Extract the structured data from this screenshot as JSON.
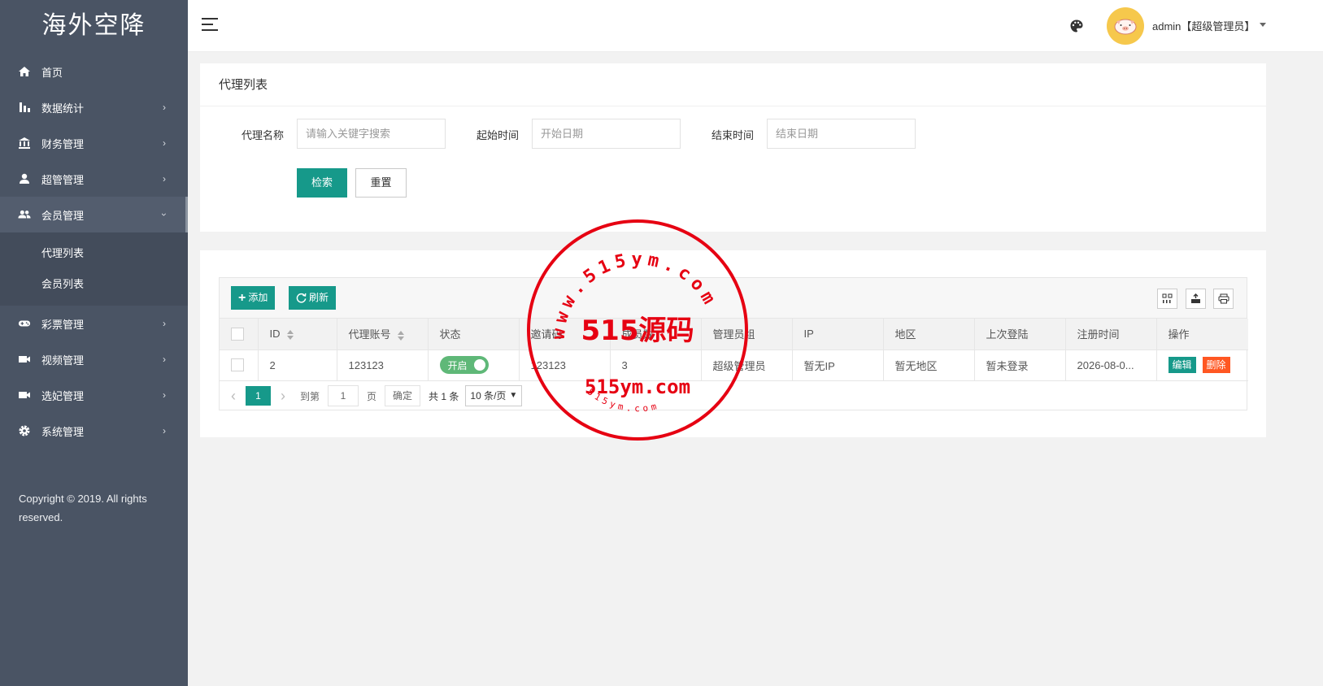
{
  "sidebar": {
    "logo": "海外空降",
    "items": [
      {
        "label": "首页",
        "icon": "home-icon",
        "arrow": ""
      },
      {
        "label": "数据统计",
        "icon": "bar-chart-icon",
        "arrow": "›"
      },
      {
        "label": "财务管理",
        "icon": "bank-icon",
        "arrow": "›"
      },
      {
        "label": "超管管理",
        "icon": "user-icon",
        "arrow": "›"
      },
      {
        "label": "会员管理",
        "icon": "users-icon",
        "arrow": "›"
      },
      {
        "label": "彩票管理",
        "icon": "gamepad-icon",
        "arrow": "›"
      },
      {
        "label": "视频管理",
        "icon": "video-icon",
        "arrow": "›"
      },
      {
        "label": "选妃管理",
        "icon": "camera-icon",
        "arrow": "›"
      },
      {
        "label": "系统管理",
        "icon": "gear-icon",
        "arrow": "›"
      }
    ],
    "sub_items": [
      "代理列表",
      "会员列表"
    ],
    "copyright": "Copyright © 2019. All rights reserved."
  },
  "header": {
    "user": "admin【超级管理员】"
  },
  "filter": {
    "title": "代理列表",
    "agent_label": "代理名称",
    "agent_placeholder": "请输入关键字搜索",
    "start_label": "起始时间",
    "start_placeholder": "开始日期",
    "end_label": "结束时间",
    "end_placeholder": "结束日期",
    "search_btn": "检索",
    "reset_btn": "重置"
  },
  "table": {
    "add_btn": "添加",
    "refresh_btn": "刷新",
    "columns": [
      "ID",
      "代理账号",
      "状态",
      "邀请码",
      "成员数",
      "管理员组",
      "IP",
      "地区",
      "上次登陆",
      "注册时间",
      "操作"
    ],
    "rows": [
      {
        "id": "2",
        "account": "123123",
        "status": "开启",
        "code": "123123",
        "members": "3",
        "group": "超级管理员",
        "ip": "暂无IP",
        "region": "暂无地区",
        "last_login": "暂未登录",
        "reg_time": "2026-08-0...",
        "edit": "编辑",
        "delete": "删除"
      }
    ]
  },
  "pager": {
    "prev": "‹",
    "current": "1",
    "next": "›",
    "goto_label": "到第",
    "goto_value": "1",
    "page_unit": "页",
    "confirm": "确定",
    "total": "共 1 条",
    "page_size": "10 条/页"
  },
  "watermark": {
    "center": "515源码",
    "domain": "515ym.com",
    "ring_top": "www.515ym.com",
    "ring_bottom": "515ym.com",
    "color": "#e60012"
  },
  "colors": {
    "sidebar": "#4a5464",
    "primary": "#16998a",
    "switch_on": "#5fb878",
    "danger": "#ff5722"
  }
}
